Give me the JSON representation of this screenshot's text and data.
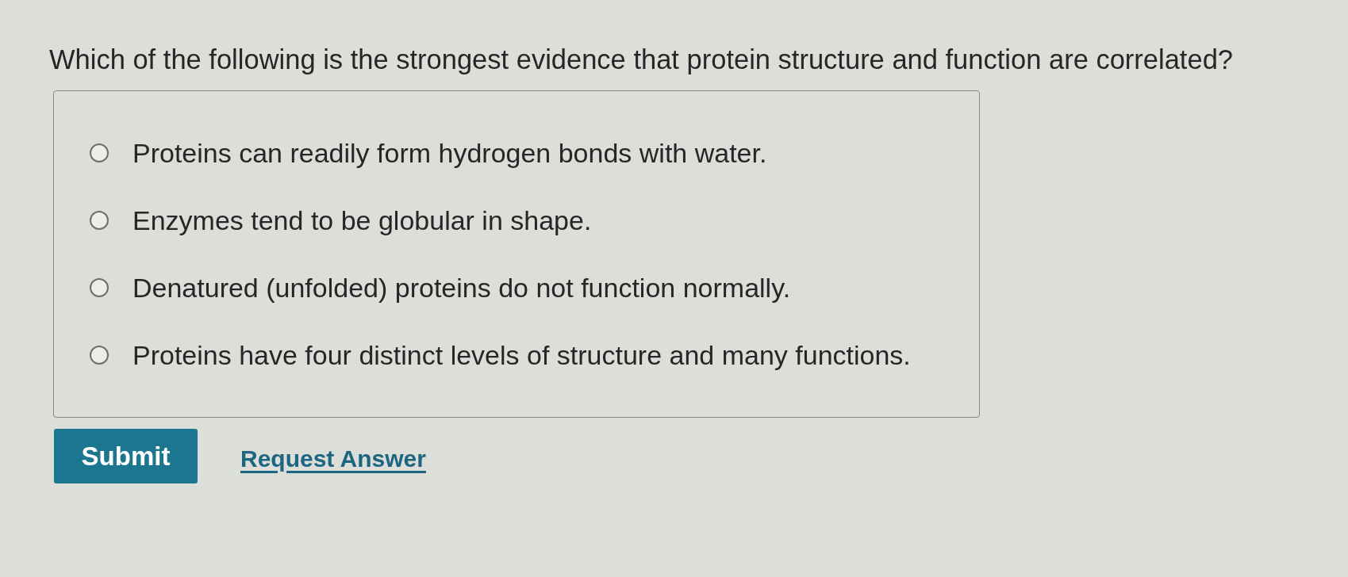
{
  "question": {
    "text": "Which of the following is the strongest evidence that protein structure and function are correlated?"
  },
  "options": [
    {
      "label": "Proteins can readily form hydrogen bonds with water.",
      "selected": false
    },
    {
      "label": "Enzymes tend to be globular in shape.",
      "selected": false
    },
    {
      "label": "Denatured (unfolded) proteins do not function normally.",
      "selected": false
    },
    {
      "label": "Proteins have four distinct levels of structure and many functions.",
      "selected": false
    }
  ],
  "actions": [
    {
      "kind": "primary",
      "label": "Submit"
    },
    {
      "kind": "link",
      "label": "Request Answer"
    }
  ]
}
